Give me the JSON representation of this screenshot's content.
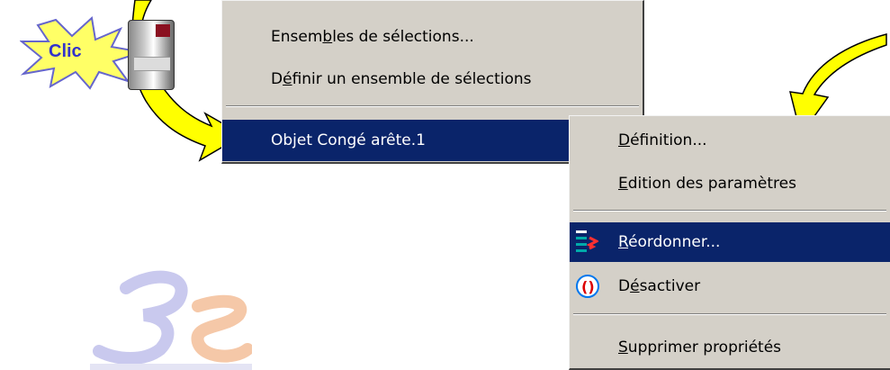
{
  "callout": {
    "label": "Clic"
  },
  "context_menu": {
    "items": [
      {
        "pre": "Ensem",
        "acc": "b",
        "post": "les de sélections..."
      },
      {
        "pre": "D",
        "acc": "é",
        "post": "finir un ensemble de sélections"
      },
      {
        "pre": "Objet Congé arête.1",
        "acc": "",
        "post": ""
      }
    ]
  },
  "submenu": {
    "items": [
      {
        "pre": "",
        "acc": "D",
        "post": "éfinition..."
      },
      {
        "pre": "",
        "acc": "E",
        "post": "dition des paramètres"
      },
      {
        "pre": "",
        "acc": "R",
        "post": "éordonner...",
        "icon": "reorder-icon"
      },
      {
        "pre": "D",
        "acc": "é",
        "post": "sactiver",
        "icon": "deactivate-icon"
      },
      {
        "pre": "",
        "acc": "S",
        "post": "upprimer propriétés"
      }
    ]
  },
  "colors": {
    "menu_bg": "#d4d0c8",
    "highlight": "#0a246a",
    "arrow_fill": "#ffff00",
    "callout_text": "#3333cc"
  }
}
